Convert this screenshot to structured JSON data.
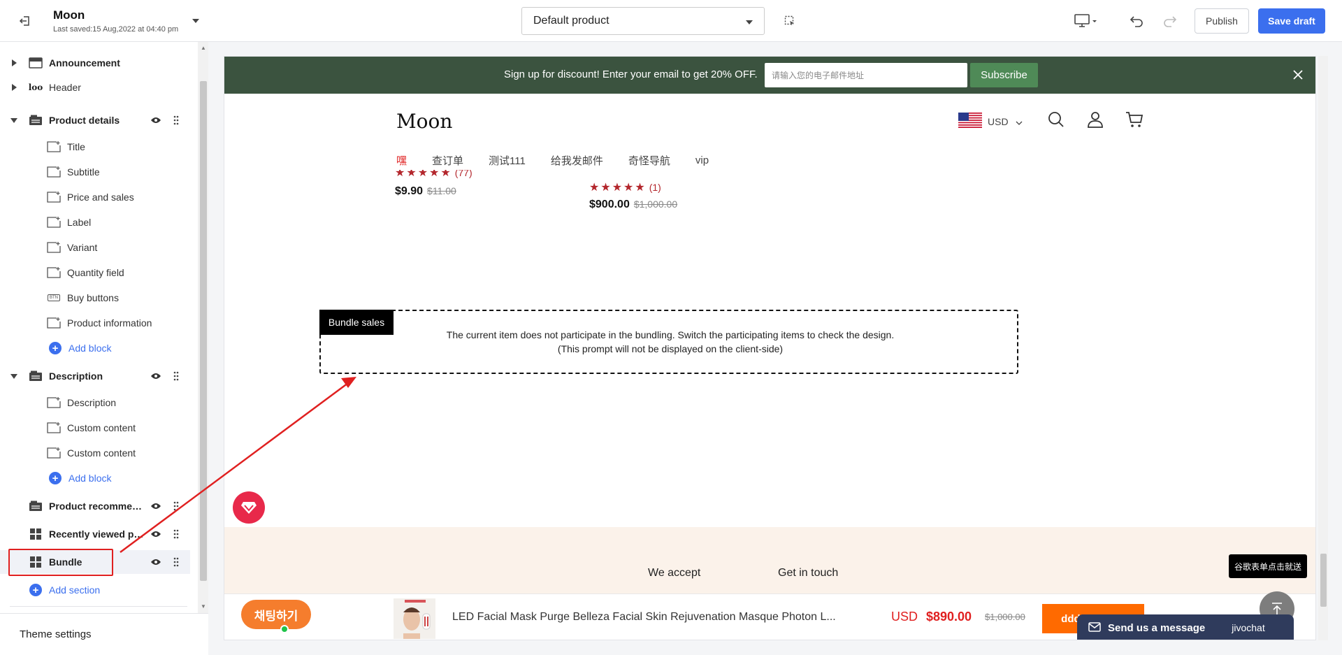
{
  "topbar": {
    "store_name": "Moon",
    "last_saved": "Last saved:15 Aug,2022 at 04:40 pm",
    "product_select": "Default product",
    "publish_label": "Publish",
    "save_label": "Save draft"
  },
  "sidebar": {
    "sections": [
      {
        "label": "Announcement",
        "icon": "announcement-section-icon"
      },
      {
        "label": "Header",
        "icon": "header-section-icon"
      },
      {
        "label": "Product details",
        "icon": "section-icon",
        "blocks": [
          "Title",
          "Subtitle",
          "Price and sales",
          "Label",
          "Variant",
          "Quantity field",
          "Buy buttons",
          "Product information"
        ],
        "add_block": "Add block"
      },
      {
        "label": "Description",
        "icon": "section-icon",
        "blocks": [
          "Description",
          "Custom content",
          "Custom content"
        ],
        "add_block": "Add block"
      },
      {
        "label": "Product recommen...",
        "icon": "section-icon"
      },
      {
        "label": "Recently viewed pr...",
        "icon": "grid-section-icon"
      },
      {
        "label": "Bundle",
        "icon": "grid-section-icon"
      }
    ],
    "add_section": "Add section",
    "theme_settings": "Theme settings",
    "header_icon_text": "loo",
    "buy_buttons_icon_text": "BTN"
  },
  "preview": {
    "announcement": {
      "text": "Sign up for discount! Enter your email to get 20% OFF.",
      "email_placeholder": "请输入您的电子邮件地址",
      "subscribe_label": "Subscribe"
    },
    "logo": "Moon",
    "currency": "USD",
    "nav": [
      "嘿",
      "查订单",
      "测试111",
      "给我发邮件",
      "奇怪导航",
      "vip"
    ],
    "products": [
      {
        "rating_count": "(77)",
        "price": "$9.90",
        "old_price": "$11.00"
      },
      {
        "rating_count": "(1)",
        "price": "$900.00",
        "old_price": "$1,000.00"
      }
    ],
    "bundle": {
      "tag": "Bundle sales",
      "line1": "The current item does not participate in the bundling. Switch the participating items to check the design.",
      "line2": "(This prompt will not be displayed on the client-side)"
    },
    "footer": {
      "we_accept": "We accept",
      "get_in_touch": "Get in touch",
      "tooltip": "谷歌表单点击就送"
    },
    "sticky": {
      "chat_label": "채팅하기",
      "title": "LED Facial Mask Purge Belleza Facial Skin Rejuvenation Masque Photon L...",
      "currency": "USD",
      "price": "$890.00",
      "old_price": "$1,000.00",
      "cta": "dddddddddd"
    },
    "jivo": {
      "message": "Send us a message",
      "brand": "jivochat"
    }
  },
  "colors": {
    "accent": "#3b6fee",
    "announce_bg": "#3b533f",
    "subscribe_bg": "#4f8a57",
    "highlight": "#e02020",
    "cta": "#ff6a00"
  }
}
